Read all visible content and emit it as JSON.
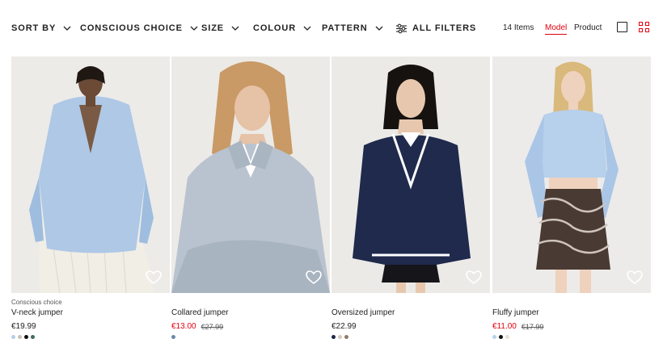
{
  "filters": {
    "sort_by": "Sort by",
    "conscious_choice": "Conscious choice",
    "size": "Size",
    "colour": "Colour",
    "pattern": "Pattern",
    "all_filters": "All filters"
  },
  "results": {
    "count_label": "14 Items",
    "view_model": "Model",
    "view_product": "Product",
    "active_view": "Model"
  },
  "colors": {
    "accent": "#e50010",
    "text": "#222222"
  },
  "products": [
    {
      "tag": "Conscious choice",
      "name": "V-neck jumper",
      "price": "€19.99",
      "old_price": "",
      "on_sale": false,
      "swatches": [
        "#b8cde6",
        "#c9c2b5",
        "#111111",
        "#3f6e5c"
      ]
    },
    {
      "tag": "",
      "name": "Collared jumper",
      "price": "€13.00",
      "old_price": "€27.99",
      "on_sale": true,
      "swatches": [
        "#6f86a8"
      ]
    },
    {
      "tag": "",
      "name": "Oversized jumper",
      "price": "€22.99",
      "old_price": "",
      "on_sale": false,
      "swatches": [
        "#1e2747",
        "#d9c8b8",
        "#8d7b6b"
      ]
    },
    {
      "tag": "",
      "name": "Fluffy jumper",
      "price": "€11.00",
      "old_price": "€17.99",
      "on_sale": true,
      "swatches": [
        "#b8d1ec",
        "#111111",
        "#e8e2d6"
      ]
    }
  ],
  "icons": {
    "chevron": "chevron-down-icon",
    "filters": "sliders-icon",
    "favourite": "heart-icon",
    "single_view": "single-grid-icon",
    "four_view": "four-grid-icon"
  }
}
